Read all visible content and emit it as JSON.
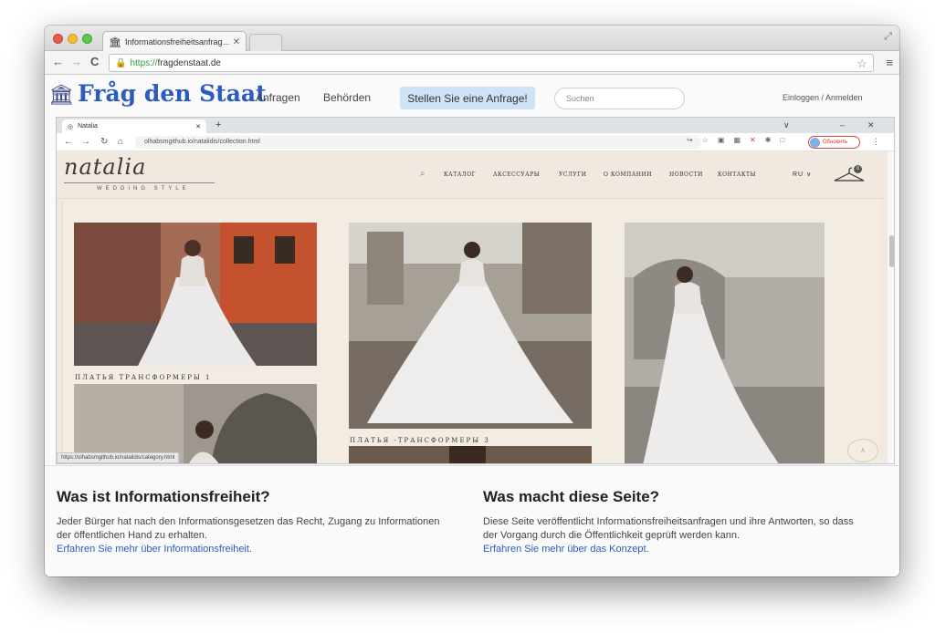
{
  "outer_tab": {
    "title": "Informationsfreiheitsanfrag…"
  },
  "address": {
    "scheme": "https://",
    "host": "fragdenstaat.de"
  },
  "fds": {
    "logo": "Fråg den Staat",
    "nav": [
      "Anfragen",
      "Behörden"
    ],
    "cta": "Stellen Sie eine Anfrage!",
    "search_placeholder": "Suchen",
    "login": "Einloggen / Anmelden"
  },
  "inner_browser": {
    "tab_title": "Natalia",
    "url": "olhabsmgithub.io/natalidis/collection.html",
    "profile_label": "Обновить",
    "status_url": "https://olhabsmgithub.io/natalidis/category.html"
  },
  "site": {
    "brand": "natalia",
    "brand_sub": "WEDDING STYLE",
    "nav": [
      "КАТАЛОГ",
      "АКСЕССУАРЫ",
      "УСЛУГИ",
      "О КОМПАНИИ",
      "НОВОСТИ",
      "КОНТАКТЫ"
    ],
    "lang": "RU",
    "cart_count": "0",
    "captions": [
      "ПЛАТЬЯ ТРАНСФОРМЕРЫ 1",
      "ПЛАТЬЯ -ТРАНСФОРМЕРЫ 3"
    ]
  },
  "info": {
    "left": {
      "title": "Was ist Informationsfreiheit?",
      "text": "Jeder Bürger hat nach den Informationsgesetzen das Recht, Zugang zu Informationen der öffentlichen Hand zu erhalten.",
      "link": "Erfahren Sie mehr über Informationsfreiheit."
    },
    "right": {
      "title": "Was macht diese Seite?",
      "text": "Diese Seite veröffentlicht Informationsfreiheitsanfragen und ihre Antworten, so dass der Vorgang durch die Öffentlichkeit geprüft werden kann.",
      "link": "Erfahren Sie mehr über das Konzept."
    }
  },
  "colors": {
    "fds_blue": "#2b5bbd",
    "cta_bg": "#cfe3f7",
    "site_bg": "#f1e9df",
    "profile_red": "#e3453a"
  },
  "icons": [
    "close-traffic-icon",
    "lock-icon",
    "star-icon",
    "hamburger-icon",
    "search-icon",
    "hanger-cart-icon",
    "scroll-up-icon"
  ]
}
